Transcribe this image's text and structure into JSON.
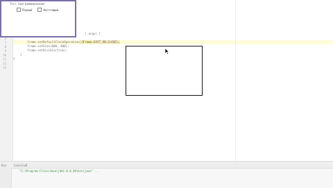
{
  "editor": {
    "line_numbers": [
      "6",
      "7",
      "8",
      "9",
      "10",
      "11",
      "12",
      "13"
    ],
    "code_lines": [
      {
        "pre": "                                         ) args) {",
        "hl": "",
        "const": "",
        "post": ""
      },
      {
        "pre": "        frame.setDefaultCloseOperation(",
        "hl": "JFrame.",
        "const": "EXIT_ON_CLOSE",
        "post": ");"
      },
      {
        "pre": "        frame.setSize(600, 400);",
        "hl": "",
        "const": "",
        "post": ""
      },
      {
        "pre": "        frame.setVisible(true);",
        "hl": "",
        "const": "",
        "post": ""
      },
      {
        "pre": "    }",
        "hl": "",
        "const": "",
        "post": ""
      },
      {
        "pre": "}",
        "hl": "",
        "const": "",
        "post": ""
      }
    ]
  },
  "popup": {
    "title": "Тест программирования",
    "options": [
      "Первый",
      "Настоящий"
    ]
  },
  "run_panel": {
    "tab_label": "Run",
    "config_name": "ConsoleB",
    "console_text": "\"C:\\Program Files\\Java\\jdk1.8.0_66\\bin\\java\" ..."
  }
}
